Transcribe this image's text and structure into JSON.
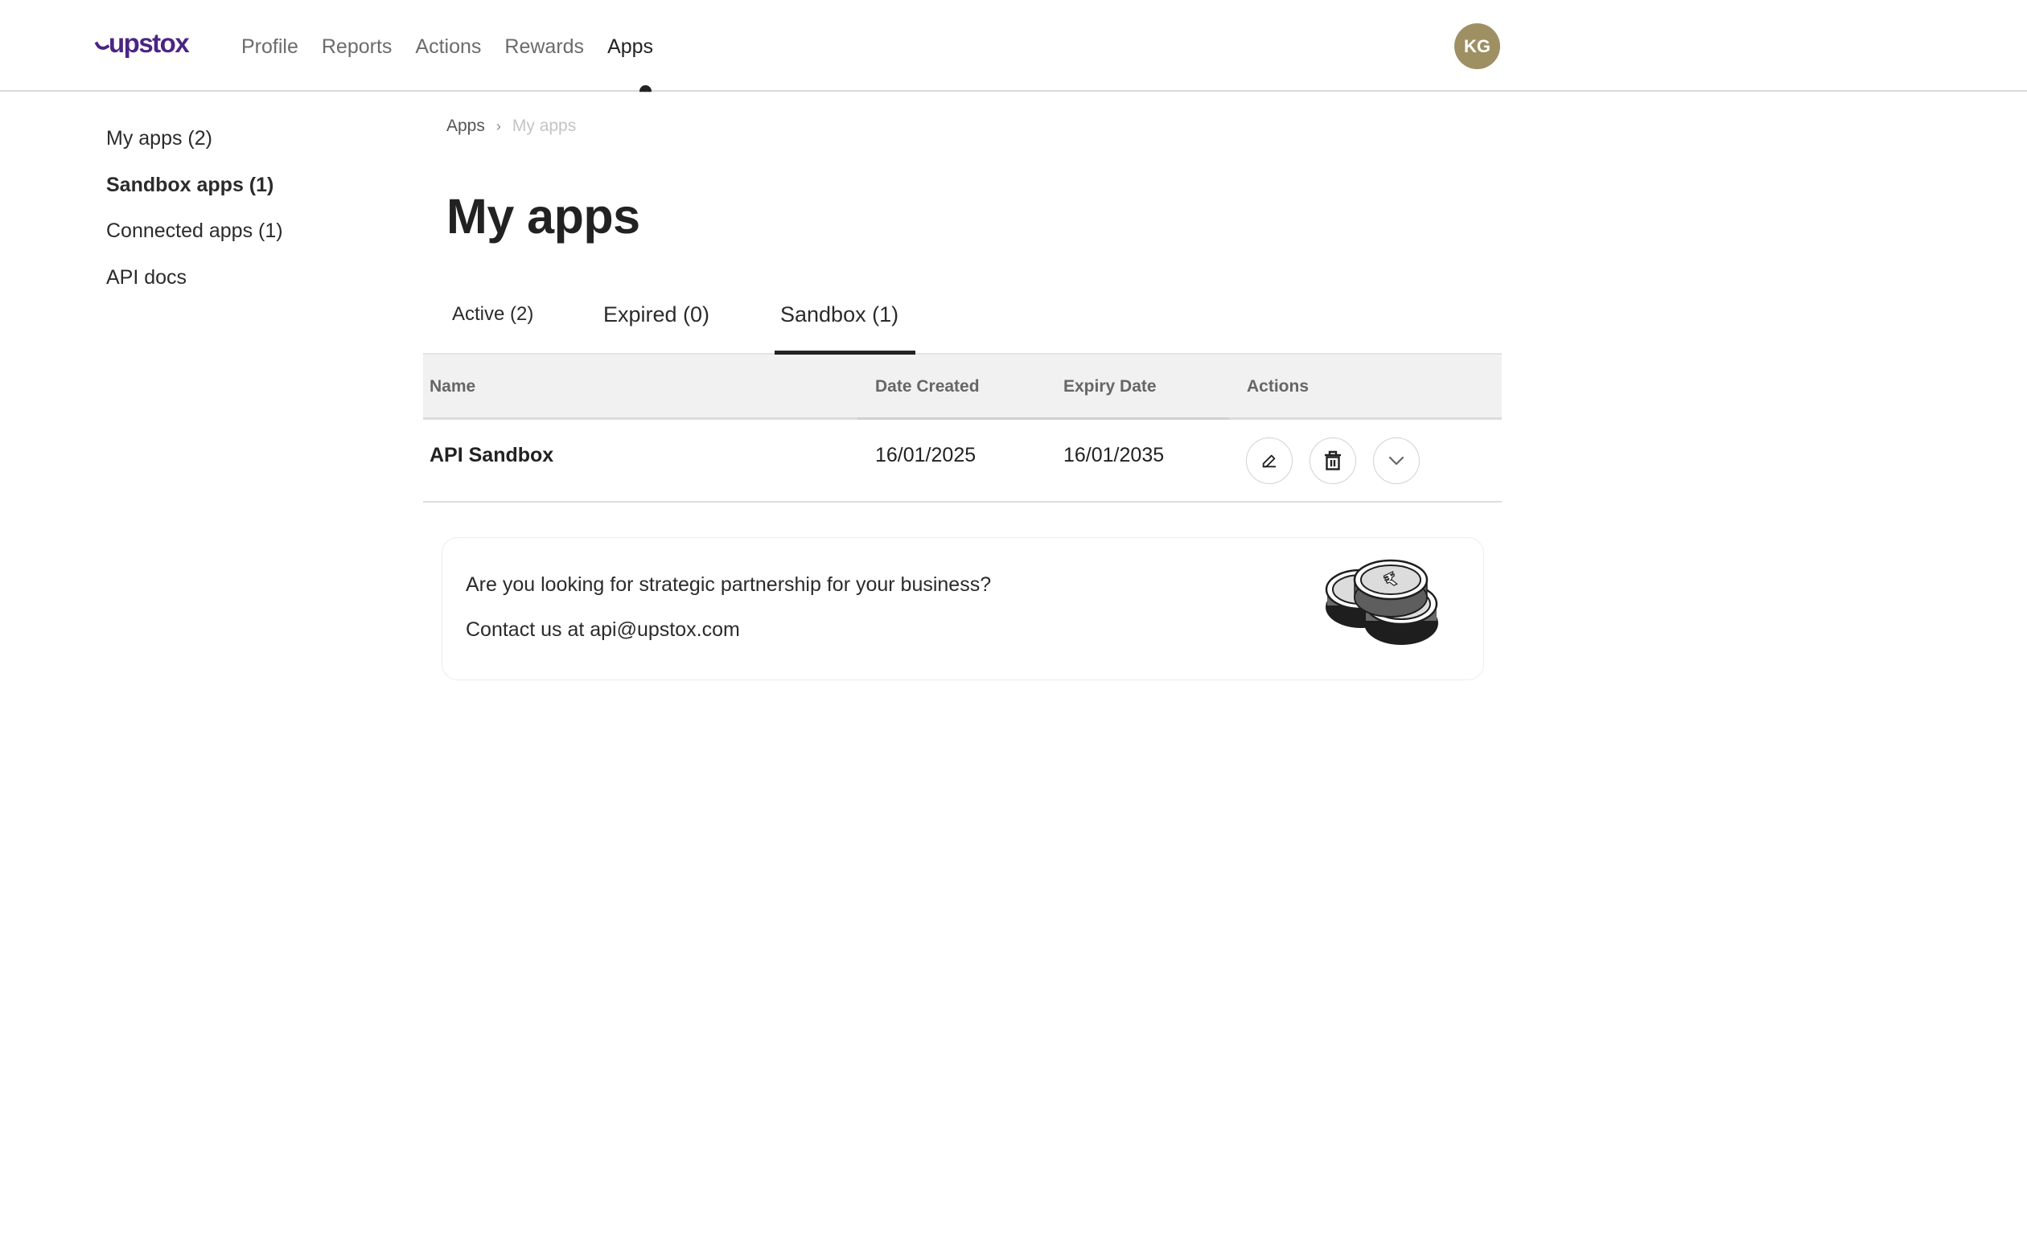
{
  "header": {
    "logo": "upstox",
    "nav": [
      {
        "label": "Profile",
        "active": false
      },
      {
        "label": "Reports",
        "active": false
      },
      {
        "label": "Actions",
        "active": false
      },
      {
        "label": "Rewards",
        "active": false
      },
      {
        "label": "Apps",
        "active": true
      }
    ],
    "avatar_initials": "KG",
    "avatar_color": "#9e9063",
    "brand_color": "#4b2483"
  },
  "sidebar": {
    "items": [
      {
        "label": "My apps (2)",
        "active": false
      },
      {
        "label": "Sandbox apps (1)",
        "active": true
      },
      {
        "label": "Connected apps (1)",
        "active": false
      },
      {
        "label": "API docs",
        "active": false
      }
    ]
  },
  "breadcrumb": {
    "parent": "Apps",
    "separator": "›",
    "current": "My apps"
  },
  "page_title": "My apps",
  "tabs": [
    {
      "label": "Active (2)",
      "active": false
    },
    {
      "label": "Expired (0)",
      "active": false
    },
    {
      "label": "Sandbox (1)",
      "active": true
    }
  ],
  "table": {
    "columns": [
      "Name",
      "Date Created",
      "Expiry Date",
      "Actions"
    ],
    "rows": [
      {
        "name": "API Sandbox",
        "date_created": "16/01/2025",
        "expiry_date": "16/01/2035",
        "actions": [
          "edit-icon",
          "trash-icon",
          "chevron-down-icon"
        ]
      }
    ]
  },
  "partnership_card": {
    "question": "Are you looking for strategic partnership for your business?",
    "contact_prefix": "Contact us at ",
    "contact_email": "api@upstox.com",
    "illustration": "rupee-coins-icon"
  }
}
